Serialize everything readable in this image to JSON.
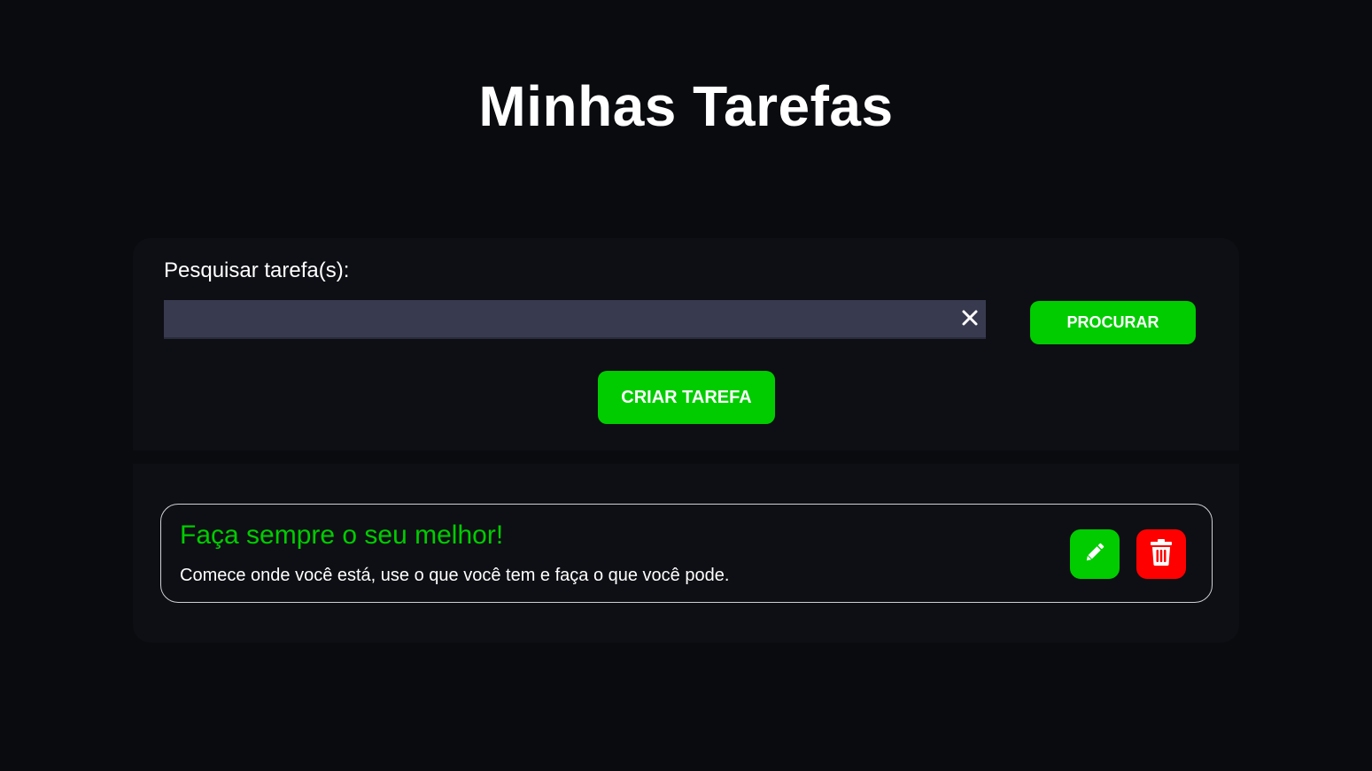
{
  "header": {
    "title": "Minhas Tarefas"
  },
  "search": {
    "label": "Pesquisar tarefa(s):",
    "value": "",
    "placeholder": "",
    "clear_icon": "close-icon",
    "submit_label": "PROCURAR"
  },
  "actions": {
    "create_label": "CRIAR TAREFA"
  },
  "tasks": [
    {
      "title": "Faça sempre o seu melhor!",
      "description": "Comece onde você está, use o que você tem e faça o que você pode.",
      "edit_icon": "pencil-icon",
      "delete_icon": "trash-icon"
    }
  ],
  "colors": {
    "background": "#0a0b0f",
    "panel": "#0e0f14",
    "accent_green": "#00cc00",
    "danger_red": "#ff0000",
    "input_bg": "#383a4f"
  }
}
